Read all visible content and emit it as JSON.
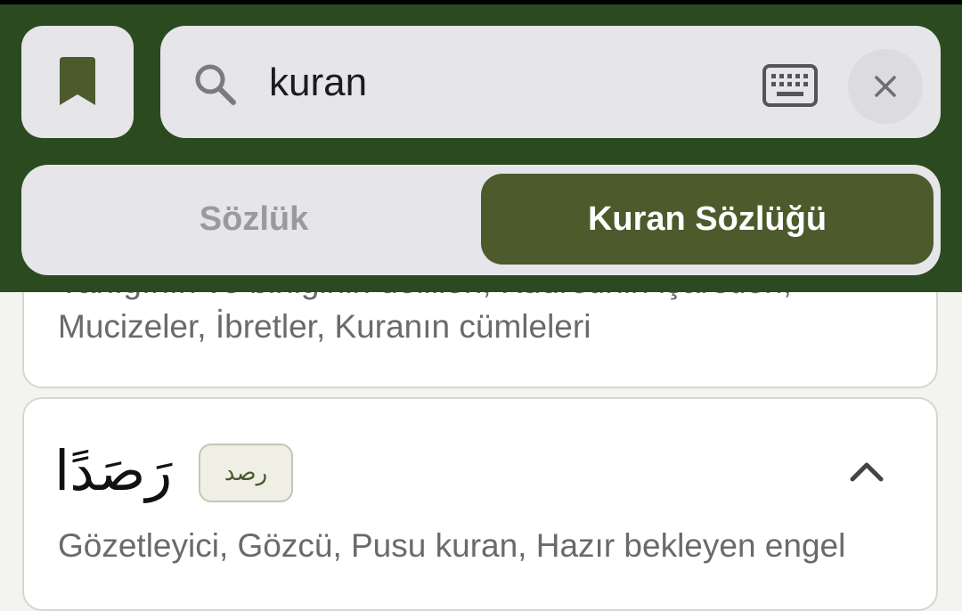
{
  "search": {
    "value": "kuran",
    "placeholder": ""
  },
  "tabs": [
    {
      "label": "Sözlük",
      "active": false
    },
    {
      "label": "Kuran Sözlüğü",
      "active": true
    }
  ],
  "results": [
    {
      "meaning": "Varlığının ve birliğinin delilleri, Kudretinin işaretleri, Mucizeler, İbretler, Kuranın cümleleri"
    },
    {
      "word": "رَصَدًا",
      "root": "رصد",
      "meaning": "Gözetleyici, Gözcü, Pusu kuran, Hazır bekleyen engel"
    }
  ],
  "icons": {
    "bookmark": "bookmark-icon",
    "search": "search-icon",
    "keyboard": "keyboard-icon",
    "clear": "close-icon",
    "expand": "chevron-up-icon"
  },
  "colors": {
    "header_bg": "#2c4a1f",
    "accent": "#4c5a2c",
    "field_bg": "#e6e5ea",
    "page_bg": "#f3f4ef"
  }
}
